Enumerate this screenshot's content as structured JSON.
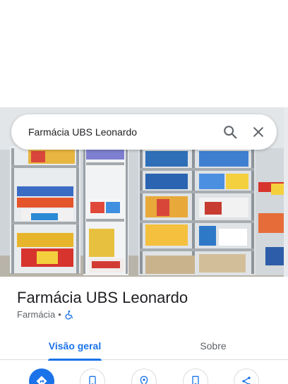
{
  "search": {
    "query": "Farmácia UBS Leonardo"
  },
  "place": {
    "name": "Farmácia UBS Leonardo",
    "category": "Farmácia",
    "separator": "•",
    "accessibility_icon": "wheelchair-icon"
  },
  "tabs": [
    {
      "label": "Visão geral",
      "active": true
    },
    {
      "label": "Sobre",
      "active": false
    }
  ],
  "actions": [
    {
      "icon": "directions-icon"
    },
    {
      "icon": "phone-icon"
    },
    {
      "icon": "location-icon"
    },
    {
      "icon": "save-icon"
    },
    {
      "icon": "share-icon"
    }
  ],
  "colors": {
    "accent": "#1a73e8",
    "text_primary": "#202124",
    "text_secondary": "#5f6368"
  }
}
